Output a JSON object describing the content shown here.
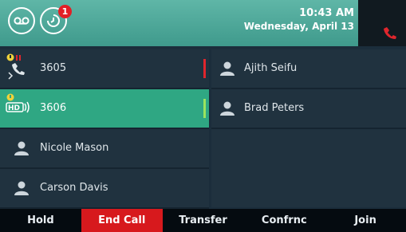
{
  "header": {
    "time": "10:43 AM",
    "date": "Wednesday, April 13",
    "missed_calls_badge": "1"
  },
  "lines": [
    {
      "label": "3605",
      "state": "held",
      "indicator_color": "#e0262d",
      "icon": "phone-held-icon"
    },
    {
      "label": "3606",
      "state": "active",
      "indicator_color": "#9be35f",
      "icon": "hd-audio-icon",
      "icon_text": "HD"
    }
  ],
  "contacts_left": [
    {
      "name": "Nicole Mason"
    },
    {
      "name": "Carson Davis"
    }
  ],
  "contacts_right": [
    {
      "name": "Ajith Seifu"
    },
    {
      "name": "Brad Peters"
    }
  ],
  "softkeys": [
    {
      "label": "Hold"
    },
    {
      "label": "End Call",
      "color": "#d7191d"
    },
    {
      "label": "Transfer"
    },
    {
      "label": "Confrnc"
    },
    {
      "label": "Join"
    }
  ],
  "colors": {
    "header": "#4fa99a",
    "active_line": "#2fa783",
    "background": "#1b2d3b",
    "end_call": "#d7191d"
  }
}
